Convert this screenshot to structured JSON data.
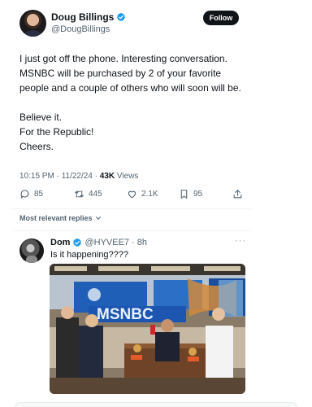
{
  "author": {
    "name": "Doug Billings",
    "handle": "@DougBillings",
    "verified": true
  },
  "follow_label": "Follow",
  "tweet": {
    "lines": [
      "I just got off the phone. Interesting conversation. MSNBC will be purchased by 2 of your favorite people and a couple of others who will soon will be.",
      "Believe it.",
      "For the Republic!",
      "Cheers."
    ],
    "time": "10:15 PM",
    "date": "11/22/24",
    "views_count": "43K",
    "views_label": "Views"
  },
  "actions": {
    "replies": "85",
    "reposts": "445",
    "likes": "2.1K",
    "bookmarks": "95"
  },
  "sort_label": "Most relevant replies",
  "reply": {
    "name": "Dom",
    "handle": "@HYVEE7",
    "age": "8h",
    "text": "Is it happening????",
    "more": "···"
  },
  "photo": {
    "sign_text": "MSNBC"
  },
  "colors": {
    "verified": "#1d9bf0",
    "secondary_text": "#536471",
    "follow_bg": "#0f1419"
  },
  "icons": [
    "verified-badge-icon",
    "reply-icon",
    "repost-icon",
    "like-icon",
    "bookmark-icon",
    "share-icon",
    "chevron-down-icon",
    "more-icon"
  ]
}
